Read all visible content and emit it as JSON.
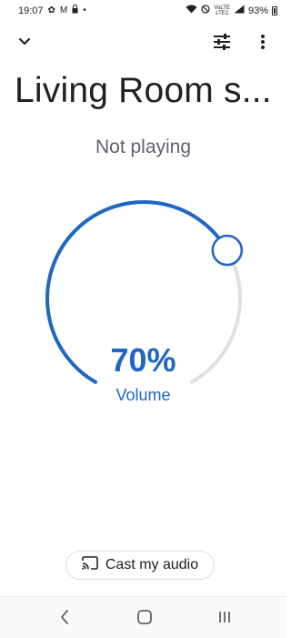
{
  "status_bar": {
    "time": "19:07",
    "left_icons": [
      "gear-icon",
      "gmail-icon",
      "lock-icon",
      "dot-icon"
    ],
    "network_label_top": "VoLTE",
    "network_label_bottom": "LTE2",
    "battery_percent": "93%",
    "battery_level": 0.93
  },
  "toolbar": {
    "collapse_icon": "chevron-down-icon",
    "equalizer_icon": "equalizer-icon",
    "menu_icon": "more-vert-icon"
  },
  "device": {
    "name": "Living Room s...",
    "playback_status": "Not playing"
  },
  "volume": {
    "level": 0.7,
    "display": "70%",
    "label": "Volume",
    "colors": {
      "active": "#1f66c6",
      "track": "#e0e0e0"
    }
  },
  "cast_button": {
    "icon": "cast-icon",
    "label": "Cast my audio"
  },
  "nav_bar": {
    "back_icon": "back-icon",
    "home_icon": "home-icon",
    "recents_icon": "recents-icon"
  }
}
